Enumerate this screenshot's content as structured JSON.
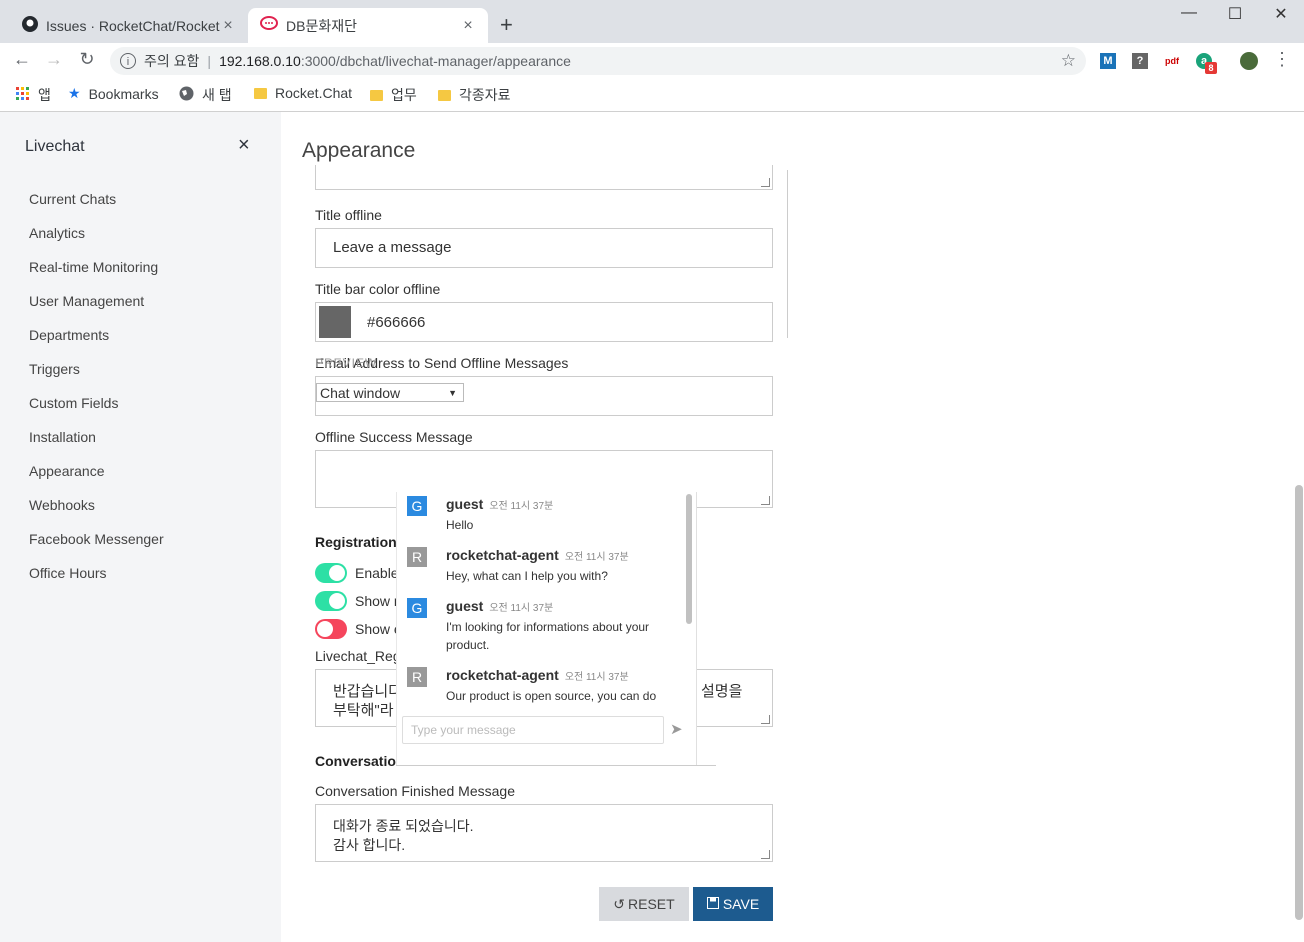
{
  "browser": {
    "tabs": [
      {
        "title": "Issues · RocketChat/Rocket.",
        "close": "×"
      },
      {
        "title": "DB문화재단",
        "close": "×"
      }
    ],
    "new_tab": "+",
    "window_controls": {
      "minimize": "—",
      "maximize": "☐",
      "close": "✕"
    },
    "address": {
      "security": "주의 요함",
      "separator": "|",
      "host": "192.168.0.10",
      "path": ":3000/dbchat/livechat-manager/appearance"
    },
    "extensions": [
      "M",
      "?",
      "pdf",
      "a"
    ],
    "extension_badge": "8",
    "bookmarks": [
      {
        "label": "앱",
        "icon": "apps-grid-icon"
      },
      {
        "label": "Bookmarks",
        "icon": "star-icon"
      },
      {
        "label": "새 탭",
        "icon": "globe-icon"
      },
      {
        "label": "Rocket.Chat",
        "icon": "folder-icon"
      },
      {
        "label": "업무",
        "icon": "folder-icon"
      },
      {
        "label": "각종자료",
        "icon": "folder-icon"
      }
    ]
  },
  "sidebar": {
    "title": "Livechat",
    "close": "×",
    "items": [
      "Current Chats",
      "Analytics",
      "Real-time Monitoring",
      "User Management",
      "Departments",
      "Triggers",
      "Custom Fields",
      "Installation",
      "Appearance",
      "Webhooks",
      "Facebook Messenger",
      "Office Hours"
    ]
  },
  "main": {
    "title": "Appearance",
    "title_offline_label": "Title offline",
    "title_offline_value": "Leave a message",
    "title_bar_color_label": "Title bar color offline",
    "title_bar_color_value": "#666666",
    "email_label": "Email Address to Send Offline Messages",
    "offline_success_label": "Offline Success Message",
    "registration_heading": "Registration",
    "toggles": [
      {
        "label": "Enable",
        "on": true
      },
      {
        "label": "Show n",
        "on": true
      },
      {
        "label": "Show e",
        "on": false
      }
    ],
    "reg_message_label": "Livechat_Reg",
    "reg_message_line1_left": "반갑습니다",
    "reg_message_line1_right": "설명을",
    "reg_message_line2": "부탁해\"라",
    "conversation_heading": "Conversation",
    "conv_finished_label": "Conversation Finished Message",
    "conv_finished_line1": "대화가 종료 되었습니다.",
    "conv_finished_line2": "감사 합니다.",
    "reset_label": "RESET",
    "save_label": "SAVE"
  },
  "preview": {
    "label": "PREVIEW",
    "select_value": "Chat window",
    "messages": [
      {
        "avatar": "G",
        "name": "guest",
        "time": "오전 11시 37분",
        "text": "Hello"
      },
      {
        "avatar": "R",
        "name": "rocketchat-agent",
        "time": "오전 11시 37분",
        "text": "Hey, what can I help you with?"
      },
      {
        "avatar": "G",
        "name": "guest",
        "time": "오전 11시 37분",
        "text": "I'm looking for informations about your product."
      },
      {
        "avatar": "R",
        "name": "rocketchat-agent",
        "time": "오전 11시 37분",
        "text": "Our product is open source, you can do"
      }
    ],
    "input_placeholder": "Type your message"
  },
  "colors": {
    "guest_avatar": "#2b8ae0",
    "agent_avatar": "#999999",
    "toggle_on": "#2de0a5",
    "toggle_off": "#f5455c",
    "save": "#1d5b8f"
  }
}
